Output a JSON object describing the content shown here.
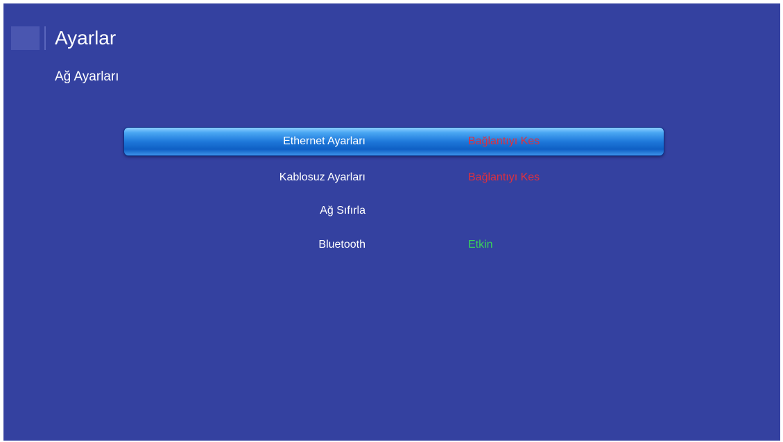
{
  "header": {
    "title": "Ayarlar"
  },
  "section": {
    "title": "Ağ Ayarları"
  },
  "colors": {
    "background": "#3441a0",
    "status_disconnect": "#e0303e",
    "status_enabled": "#3ad25a",
    "selected_highlight": "#1e78da"
  },
  "menu": {
    "items": [
      {
        "label": "Ethernet Ayarları",
        "value": "Bağlantıyı Kes",
        "selected": true
      },
      {
        "label": "Kablosuz Ayarları",
        "value": "Bağlantıyı Kes",
        "selected": false
      },
      {
        "label": "Ağ Sıfırla",
        "value": "",
        "selected": false
      },
      {
        "label": "Bluetooth",
        "value": "Etkin",
        "selected": false
      }
    ]
  }
}
